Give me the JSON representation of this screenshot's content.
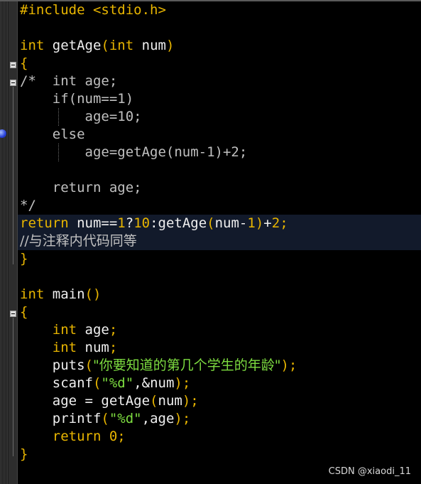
{
  "editor": {
    "line1": {
      "pp": "#include <stdio.h>"
    },
    "line3": {
      "kw1": "int",
      "id1": " getAge",
      "p1": "(",
      "kw2": "int",
      "id2": " num",
      "p2": ")"
    },
    "line4": {
      "brace": "{"
    },
    "line5": {
      "text": "/*  int age;"
    },
    "line6": {
      "text": "    if(num==1)"
    },
    "line7": {
      "text": "        age=10;"
    },
    "line8": {
      "text": "    else"
    },
    "line9": {
      "text": "        age=getAge(num-1)+2;"
    },
    "line11": {
      "text": "    return age;"
    },
    "line12": {
      "text": "*/"
    },
    "line13": {
      "kw": "return",
      "a": " num==",
      "n1": "1",
      "b": "?",
      "n2": "10",
      "c": ":getAge",
      "p1": "(",
      "d": "num-",
      "n3": "1",
      "p2": ")",
      "e": "+",
      "n4": "2",
      "f": ";"
    },
    "line14": {
      "text": "//与注释内代码同等"
    },
    "line15": {
      "brace": "}"
    },
    "line17": {
      "kw": "int",
      "id": " main",
      "p": "()"
    },
    "line18": {
      "brace": "{"
    },
    "line19": {
      "kw": "int",
      "id": " age",
      "semi": ";"
    },
    "line20": {
      "kw": "int",
      "id": " num",
      "semi": ";"
    },
    "line21": {
      "fn": "puts",
      "p1": "(",
      "str": "\"你要知道的第几个学生的年龄\"",
      "p2": ");"
    },
    "line22": {
      "fn": "scanf",
      "p1": "(",
      "str": "\"%d\"",
      "rest": ",&num",
      "p2": ");"
    },
    "line23": {
      "a": "age = getAge",
      "p1": "(",
      "b": "num",
      "p2": ");"
    },
    "line24": {
      "fn": "printf",
      "p1": "(",
      "str": "\"%d\"",
      "rest": ",age",
      "p2": ");"
    },
    "line25": {
      "kw": "return",
      "n": " 0",
      "semi": ";"
    },
    "line26": {
      "brace": "}"
    }
  },
  "watermark": "CSDN @xiaodi_11",
  "colors": {
    "keyword": "#e8b500",
    "identifier": "#f0f0f0",
    "comment": "#c0c0c0",
    "string": "#7ddc40",
    "current_line": "#121a2b"
  }
}
